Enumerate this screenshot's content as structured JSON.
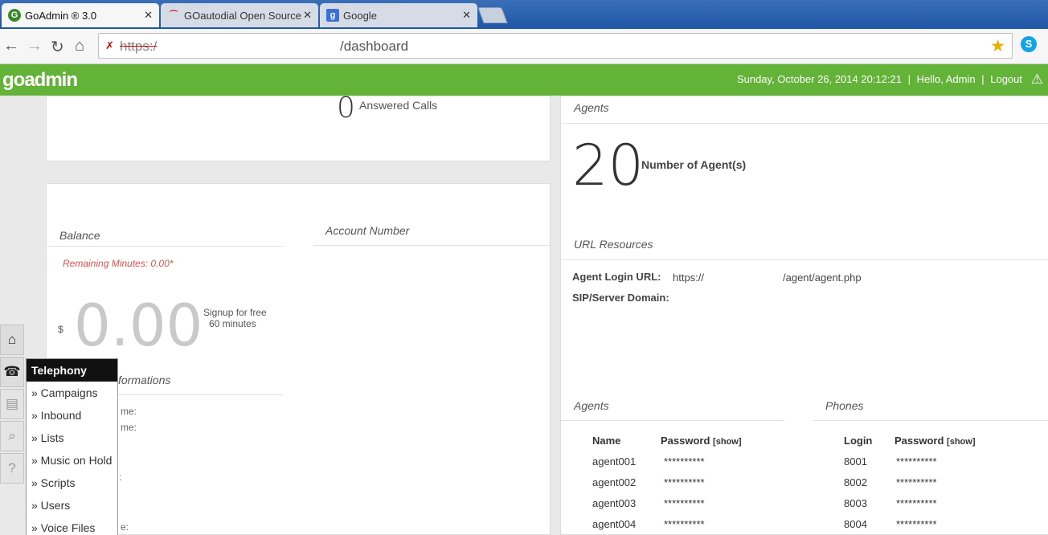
{
  "browser": {
    "tabs": [
      {
        "title": "GoAdmin ® 3.0",
        "active": true
      },
      {
        "title": "GOautodial Open Source C",
        "active": false
      },
      {
        "title": "Google",
        "active": false
      }
    ],
    "url": {
      "scheme": "https:/",
      "path": "/dashboard"
    }
  },
  "header": {
    "logo": "goadmin",
    "datetime": "Sunday, October 26, 2014 20:12:21",
    "sep1": "|",
    "greeting": "Hello, Admin",
    "sep2": "|",
    "logout": "Logout"
  },
  "calls": {
    "value": "0",
    "label": "Answered Calls"
  },
  "balance": {
    "title": "Balance",
    "remaining": "Remaining Minutes: 0.00*",
    "currency": "$",
    "amount": "0.00",
    "signup_line1": "Signup for free",
    "signup_line2": "60 minutes"
  },
  "account": {
    "title": "Account Number"
  },
  "informations": {
    "title_partial": "formations",
    "lines": [
      "me:",
      "me:",
      ":",
      "e:"
    ]
  },
  "agents_summary": {
    "title": "Agents",
    "count": "20",
    "label": "Number of Agent(s)"
  },
  "url_resources": {
    "title": "URL Resources",
    "login_label": "Agent Login URL:",
    "login_scheme": "https://",
    "login_path": "/agent/agent.php",
    "sip_label": "SIP/Server Domain:"
  },
  "agents_table": {
    "title": "Agents",
    "col_name": "Name",
    "col_password": "Password",
    "show": "[show]",
    "rows": [
      {
        "name": "agent001",
        "password": "**********"
      },
      {
        "name": "agent002",
        "password": "**********"
      },
      {
        "name": "agent003",
        "password": "**********"
      },
      {
        "name": "agent004",
        "password": "**********"
      }
    ]
  },
  "phones_table": {
    "title": "Phones",
    "col_login": "Login",
    "col_password": "Password",
    "show": "[show]",
    "rows": [
      {
        "login": "8001",
        "password": "**********"
      },
      {
        "login": "8002",
        "password": "**********"
      },
      {
        "login": "8003",
        "password": "**********"
      },
      {
        "login": "8004",
        "password": "**********"
      }
    ]
  },
  "menu": {
    "header": "Telephony",
    "items": [
      "» Campaigns",
      "» Inbound",
      "» Lists",
      "» Music on Hold",
      "» Scripts",
      "» Users",
      "» Voice Files"
    ]
  },
  "icons": {
    "home": "home-icon",
    "phone": "phone-icon",
    "reports": "reports-icon",
    "search": "search-icon",
    "help": "help-icon"
  },
  "colors": {
    "header_green": "#62b338",
    "remaining_red": "#e0524a"
  }
}
